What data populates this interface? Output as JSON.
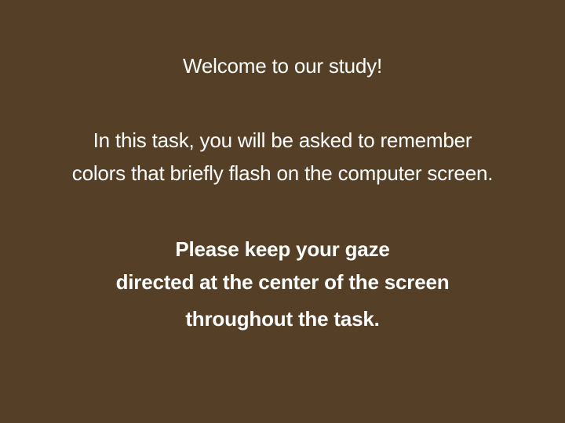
{
  "instructions": {
    "welcome": "Welcome to our study!",
    "task_line_1": "In this task, you will be asked to remember",
    "task_line_2": "colors that briefly flash on the computer screen.",
    "gaze_line_1": "Please keep your gaze",
    "gaze_line_2": "directed at the center of the screen",
    "gaze_line_3": "throughout the task."
  },
  "colors": {
    "background": "#553f26",
    "text": "#ffffff"
  }
}
